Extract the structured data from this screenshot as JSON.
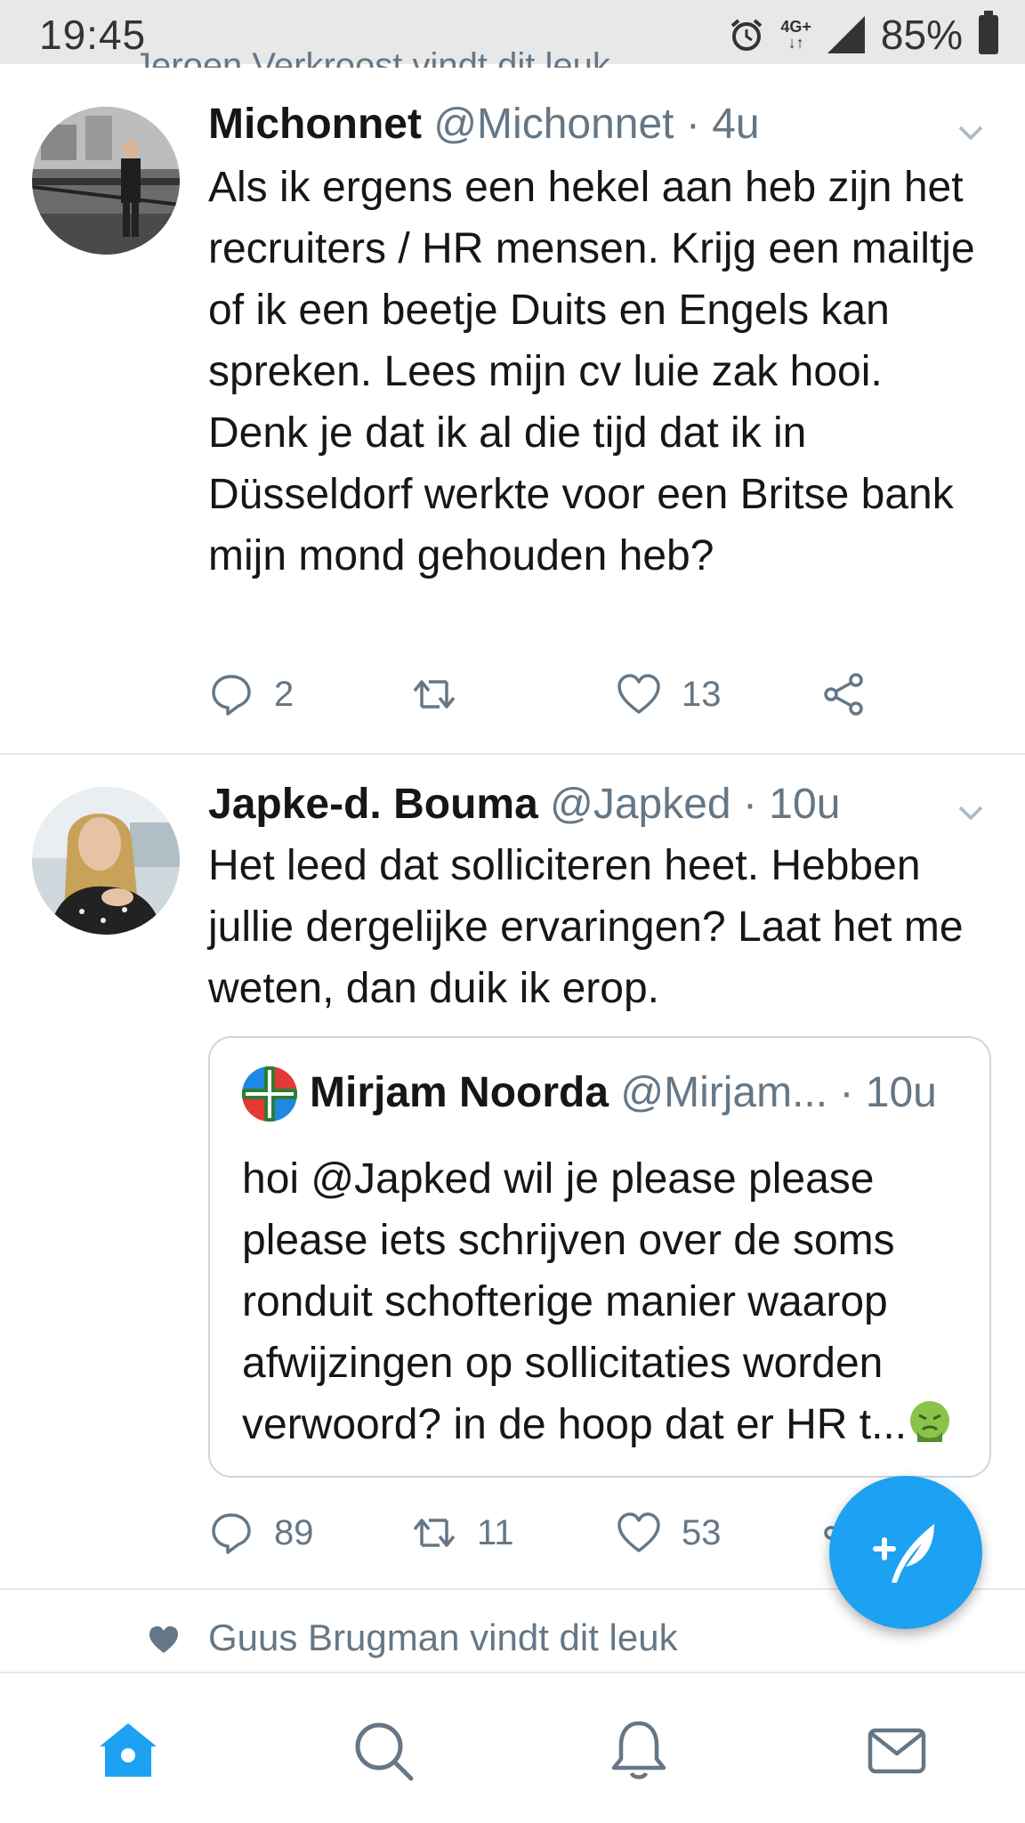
{
  "status_bar": {
    "time": "19:45",
    "network_top": "4G+",
    "network_bottom": "↓↑",
    "battery": "85%"
  },
  "top_context": {
    "text": "Jeroen Verkroost vindt dit leuk"
  },
  "tweets": [
    {
      "name": "Michonnet",
      "handle": "@Michonnet",
      "separator": "·",
      "age": "4u",
      "text": "Als ik ergens een hekel aan heb zijn het recruiters / HR mensen. Krijg een mailtje of ik een beetje Duits en Engels kan spreken. Lees mijn cv luie zak hooi. Denk je dat ik al die tijd dat ik in Düsseldorf werkte voor een Britse bank mijn mond gehouden heb?",
      "replies": "2",
      "retweets": "",
      "likes": "13"
    },
    {
      "name": "Japke-d. Bouma",
      "handle": "@Japked",
      "separator": "·",
      "age": "10u",
      "text": "Het leed dat solliciteren heet. Hebben jullie dergelijke ervaringen? Laat het me weten, dan duik ik erop.",
      "replies": "89",
      "retweets": "11",
      "likes": "53",
      "quote": {
        "name": "Mirjam Noorda",
        "handle": "@Mirjam...",
        "separator": "·",
        "age": "10u",
        "text": "hoi @Japked wil je please please please iets schrijven over de soms ronduit schofterige manier waarop afwijzingen op sollicitaties worden verwoord? in de hoop dat er HR t..."
      }
    }
  ],
  "social_context": {
    "text": "Guus Brugman vindt dit leuk"
  },
  "colors": {
    "accent": "#1da1f2",
    "secondary_text": "#657786",
    "divider": "#e1e8ed"
  },
  "icons": {
    "fab": "compose-tweet-icon",
    "tabs": [
      "home-icon",
      "search-icon",
      "notifications-icon",
      "messages-icon"
    ]
  }
}
